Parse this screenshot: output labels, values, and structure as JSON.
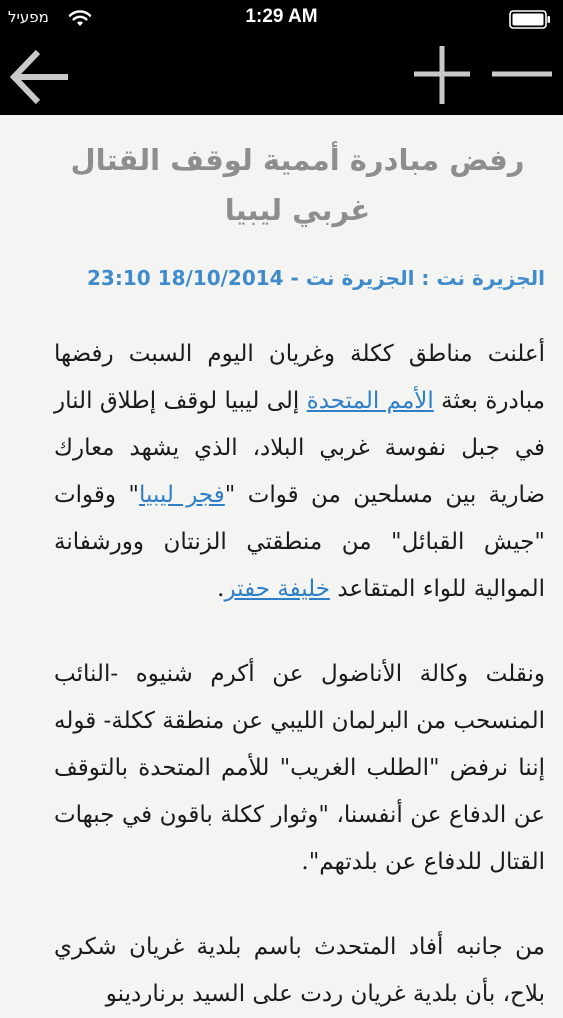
{
  "status_bar": {
    "carrier": "מפעיל",
    "time": "1:29 AM"
  },
  "nav": {
    "back_icon": "arrow-left-icon",
    "zoom_in_icon": "plus-icon",
    "zoom_out_icon": "minus-icon"
  },
  "article": {
    "title": "رفض مبادرة أممية لوقف القتال غربي ليبيا",
    "meta": "الجزيرة نت : الجزيرة نت - 18/10/2014 23:10",
    "p1": {
      "t1": "أعلنت مناطق ككلة وغريان اليوم السبت رفضها مبادرة بعثة ",
      "link1": "الأمم المتحدة",
      "t2": " إلى ليبيا لوقف إطلاق النار في جبل نفوسة غربي البلاد، الذي يشهد معارك ضارية بين مسلحين من قوات \"",
      "link2": "فجر ليبيا",
      "t3": "\" وقوات \"جيش القبائل\" من منطقتي الزنتان وورشفانة الموالية للواء المتقاعد ",
      "link3": "خليفة حفتر",
      "t4": "."
    },
    "p2": "ونقلت وكالة الأناضول عن أكرم شنيوه -النائب المنسحب من البرلمان الليبي عن منطقة ككلة- قوله إننا نرفض \"الطلب الغريب\" للأمم المتحدة بالتوقف عن الدفاع عن أنفسنا، \"وثوار ككلة باقون في جبهات القتال للدفاع عن بلدتهم\".",
    "p3": "من جانبه أفاد المتحدث باسم بلدية غريان شكري بلاح، بأن بلدية غريان ردت على السيد برناردينو"
  },
  "colors": {
    "bar_background": "#000000",
    "page_background": "#f4f4f2",
    "title": "#8e8e8e",
    "meta": "#3f8bcb",
    "link": "#2f7fc6",
    "body_text": "#1a1a1a"
  }
}
